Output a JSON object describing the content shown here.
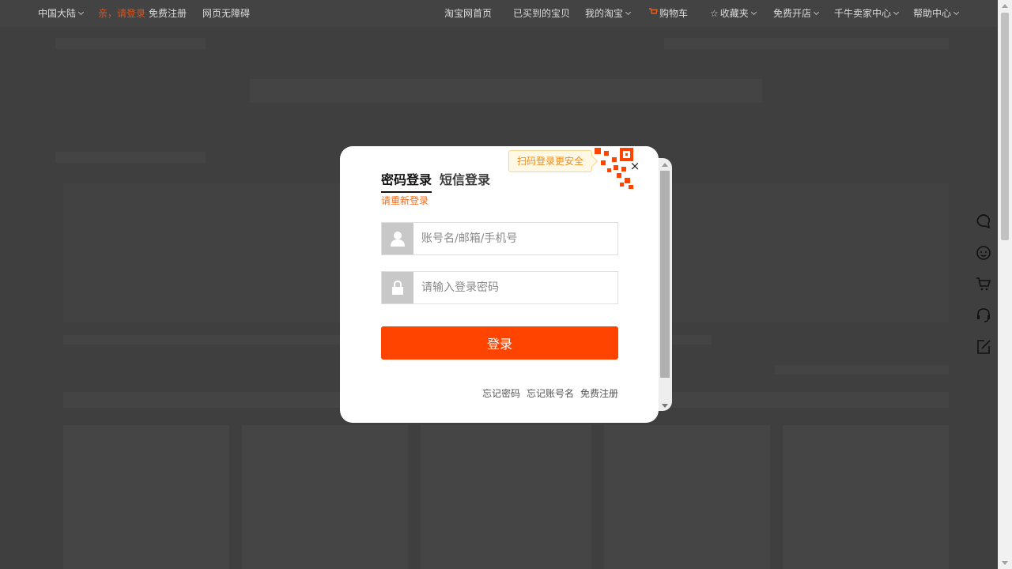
{
  "topbar": {
    "region": "中国大陆",
    "login_prompt": "亲，请登录",
    "register": "免费注册",
    "accessibility": "网页无障碍",
    "home": "淘宝网首页",
    "bought": "已买到的宝贝",
    "my_taobao": "我的淘宝",
    "cart": "购物车",
    "favorites": "收藏夹",
    "open_shop": "免费开店",
    "seller_center": "千牛卖家中心",
    "help": "帮助中心"
  },
  "right_toolbar": {
    "items": [
      {
        "icon": "bubble-icon"
      },
      {
        "icon": "smile-icon"
      },
      {
        "icon": "cart-icon"
      },
      {
        "icon": "headset-icon"
      },
      {
        "icon": "edit-icon"
      }
    ]
  },
  "login_modal": {
    "tabs": {
      "password": "密码登录",
      "sms": "短信登录"
    },
    "relogin_hint": "请重新登录",
    "qr_tip": "扫码登录更安全",
    "close": "×",
    "username_placeholder": "账号名/邮箱/手机号",
    "username_value": "",
    "password_placeholder": "请输入登录密码",
    "password_value": "",
    "submit": "登录",
    "links": {
      "forgot_password": "忘记密码",
      "forgot_username": "忘记账号名",
      "register": "免费注册"
    }
  },
  "colors": {
    "accent": "#ff4400",
    "hint": "#f06b1a",
    "overlay": "#3f3f3f"
  }
}
